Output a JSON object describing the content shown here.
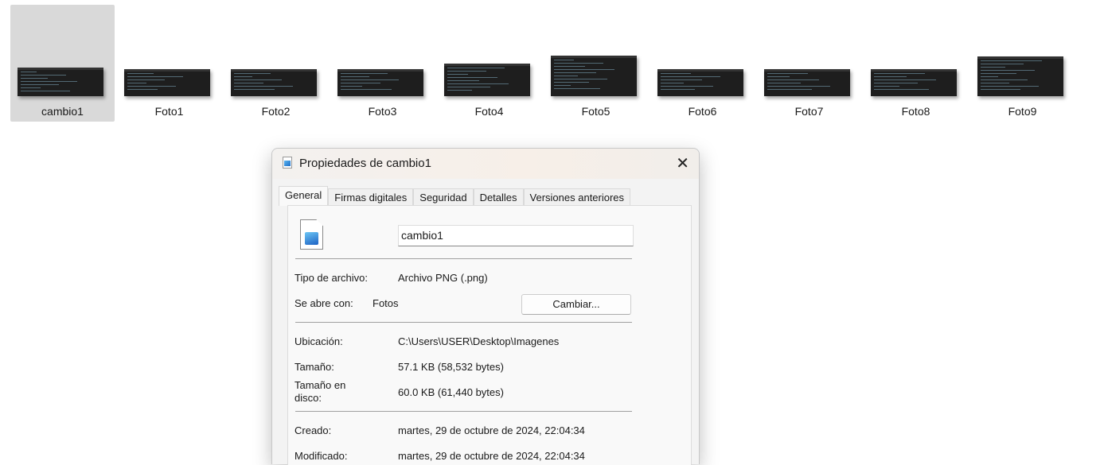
{
  "files": [
    {
      "name": "cambio1",
      "selected": true
    },
    {
      "name": "Foto1"
    },
    {
      "name": "Foto2"
    },
    {
      "name": "Foto3"
    },
    {
      "name": "Foto4"
    },
    {
      "name": "Foto5"
    },
    {
      "name": "Foto6"
    },
    {
      "name": "Foto7"
    },
    {
      "name": "Foto8"
    },
    {
      "name": "Foto9"
    }
  ],
  "dialog": {
    "title": "Propiedades de cambio1",
    "tabs": [
      "General",
      "Firmas digitales",
      "Seguridad",
      "Detalles",
      "Versiones anteriores"
    ],
    "active_tab": "General",
    "filename": "cambio1",
    "type_label": "Tipo de archivo:",
    "type_value": "Archivo PNG (.png)",
    "opens_label": "Se abre con:",
    "opens_value": "Fotos",
    "change_button": "Cambiar...",
    "location_label": "Ubicación:",
    "location_value": "C:\\Users\\USER\\Desktop\\Imagenes",
    "size_label": "Tamaño:",
    "size_value": "57.1 KB (58,532 bytes)",
    "disk_label": "Tamaño en disco:",
    "disk_value": "60.0 KB (61,440 bytes)",
    "created_label": "Creado:",
    "created_value": "martes, 29 de octubre de 2024, 22:04:34",
    "modified_label": "Modificado:",
    "modified_value": "martes, 29 de octubre de 2024, 22:04:34"
  }
}
